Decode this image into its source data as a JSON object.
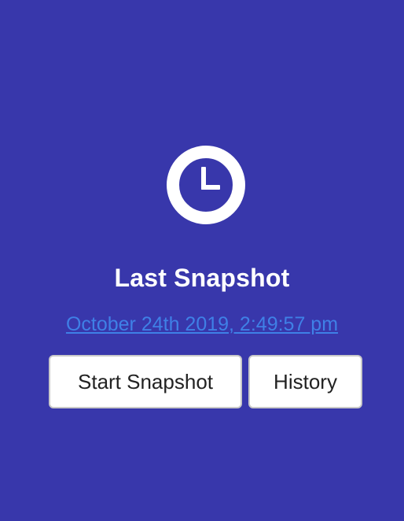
{
  "snapshot": {
    "icon": "clock-icon",
    "title": "Last Snapshot",
    "timestamp": "October 24th 2019, 2:49:57 pm"
  },
  "buttons": {
    "start_label": "Start Snapshot",
    "history_label": "History"
  },
  "colors": {
    "background": "#3837ab",
    "link": "#3f80e6",
    "button_bg": "#ffffff",
    "button_text": "#222222"
  }
}
